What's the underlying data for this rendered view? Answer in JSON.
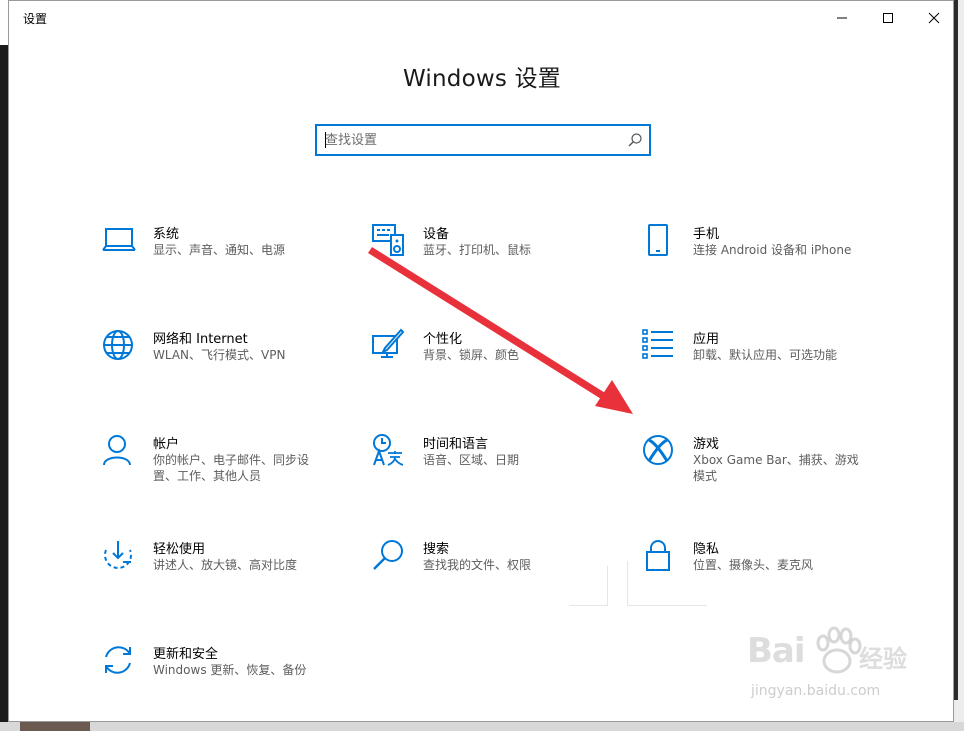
{
  "window": {
    "title": "设置"
  },
  "page": {
    "title": "Windows 设置"
  },
  "search": {
    "placeholder": "查找设置"
  },
  "tiles": [
    {
      "name": "系统",
      "desc": "显示、声音、通知、电源",
      "icon": "laptop-icon"
    },
    {
      "name": "设备",
      "desc": "蓝牙、打印机、鼠标",
      "icon": "devices-icon"
    },
    {
      "name": "手机",
      "desc": "连接 Android 设备和 iPhone",
      "icon": "phone-icon"
    },
    {
      "name": "网络和 Internet",
      "desc": "WLAN、飞行模式、VPN",
      "icon": "globe-icon"
    },
    {
      "name": "个性化",
      "desc": "背景、锁屏、颜色",
      "icon": "personalization-icon"
    },
    {
      "name": "应用",
      "desc": "卸载、默认应用、可选功能",
      "icon": "apps-list-icon"
    },
    {
      "name": "帐户",
      "desc": "你的帐户、电子邮件、同步设置、工作、其他人员",
      "icon": "person-icon"
    },
    {
      "name": "时间和语言",
      "desc": "语音、区域、日期",
      "icon": "time-language-icon"
    },
    {
      "name": "游戏",
      "desc": "Xbox Game Bar、捕获、游戏模式",
      "icon": "xbox-icon"
    },
    {
      "name": "轻松使用",
      "desc": "讲述人、放大镜、高对比度",
      "icon": "ease-of-access-icon"
    },
    {
      "name": "搜索",
      "desc": "查找我的文件、权限",
      "icon": "magnifier-icon"
    },
    {
      "name": "隐私",
      "desc": "位置、摄像头、麦克风",
      "icon": "lock-icon"
    },
    {
      "name": "更新和安全",
      "desc": "Windows 更新、恢复、备份",
      "icon": "update-icon"
    }
  ],
  "watermark": {
    "brand": "Bai",
    "brand2": "经验",
    "url": "jingyan.baidu.com"
  },
  "colors": {
    "accent": "#0078d7",
    "arrow": "#e8313a"
  }
}
